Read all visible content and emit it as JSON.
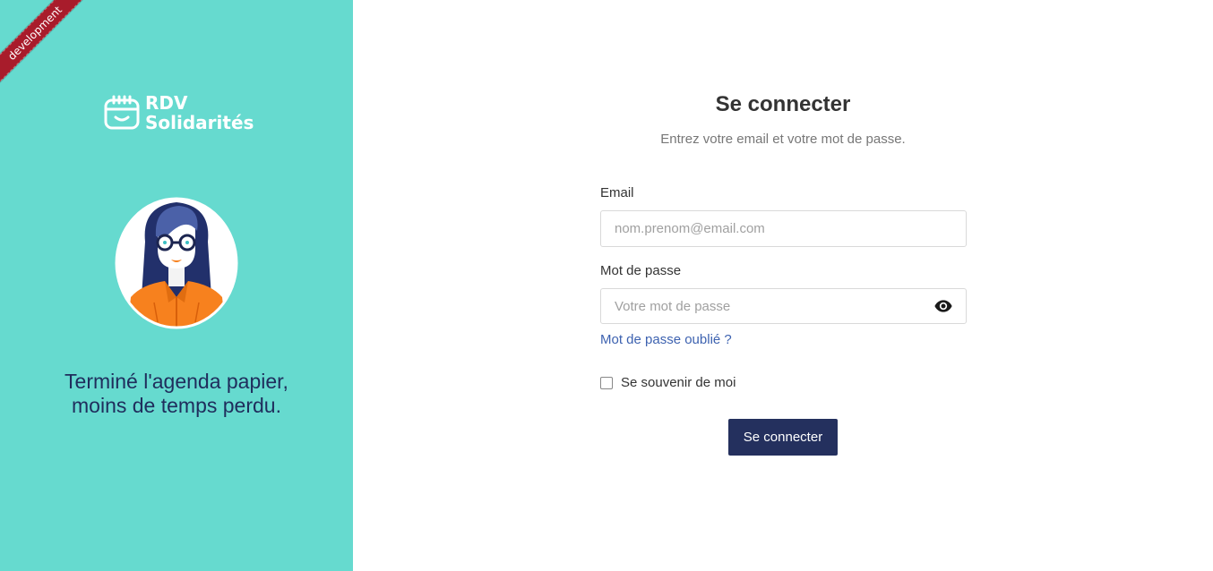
{
  "banner": {
    "environment": "development"
  },
  "brand": {
    "line1": "RDV",
    "line2": "Solidarités",
    "icon": "calendar-smile-icon"
  },
  "illustration": {
    "icon": "woman-avatar-illustration"
  },
  "tagline": "Terminé l'agenda papier, moins de temps perdu.",
  "login": {
    "title": "Se connecter",
    "subtitle": "Entrez votre email et votre mot de passe.",
    "email": {
      "label": "Email",
      "placeholder": "nom.prenom@email.com",
      "value": ""
    },
    "password": {
      "label": "Mot de passe",
      "placeholder": "Votre mot de passe",
      "value": "",
      "toggle_icon": "eye-icon"
    },
    "forgot_link": "Mot de passe oublié ?",
    "remember": {
      "label": "Se souvenir de moi",
      "checked": false
    },
    "submit_label": "Se connecter"
  },
  "colors": {
    "panel": "#66dacf",
    "ribbon": "#a81c2b",
    "primary_button": "#24305e",
    "link": "#3d62b0"
  }
}
